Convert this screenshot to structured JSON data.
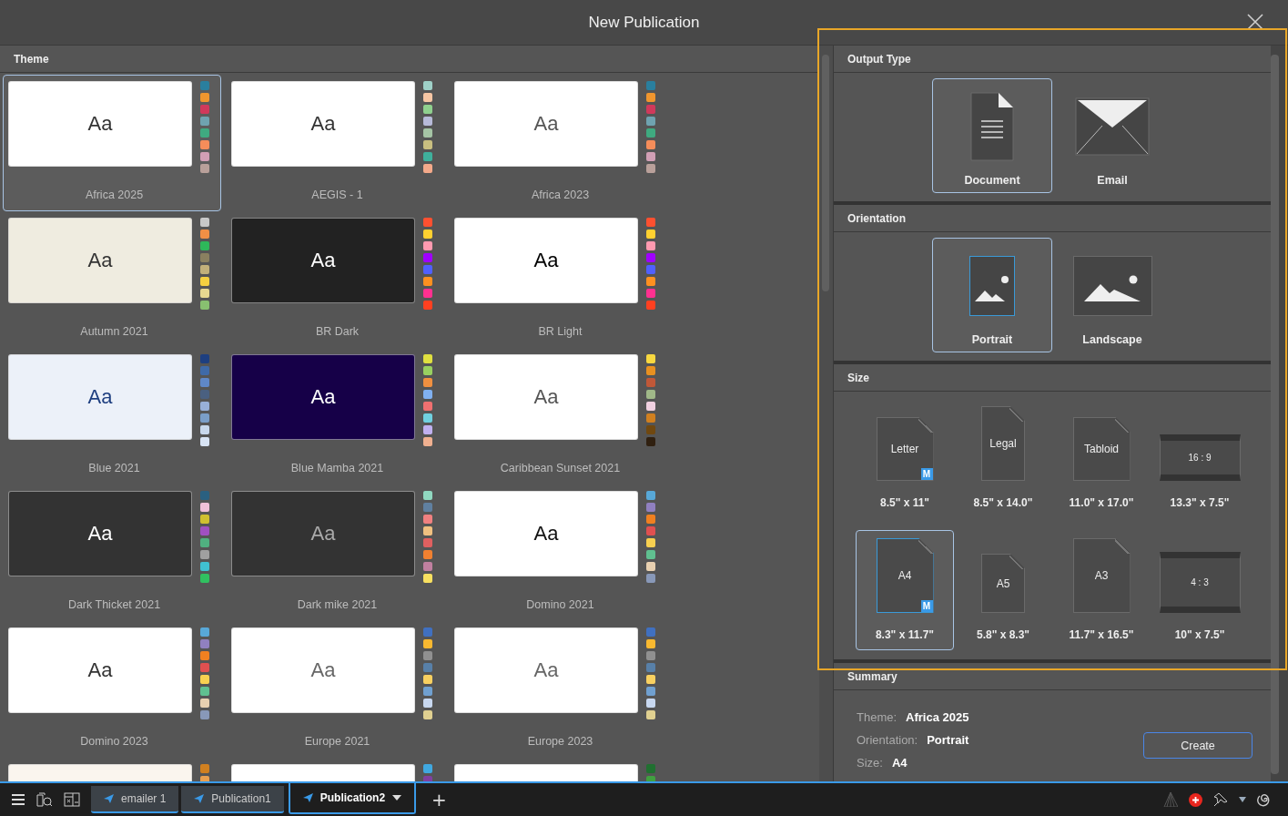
{
  "window": {
    "title": "New Publication"
  },
  "theme_panel": {
    "title": "Theme",
    "themes": [
      {
        "name": "Africa 2025",
        "sample": {
          "text": "Aa",
          "color": "#333333"
        },
        "selected": true,
        "preview": {
          "color": "#ffffff"
        },
        "swatches": [
          {
            "color": "#2a7f9e"
          },
          {
            "color": "#f0962e"
          },
          {
            "color": "#d0395b"
          },
          {
            "color": "#6fa3b0"
          },
          {
            "color": "#3faa80"
          },
          {
            "color": "#f58d5a"
          },
          {
            "color": "#d19fb5"
          },
          {
            "color": "#b9a09a"
          }
        ]
      },
      {
        "name": "AEGIS - 1",
        "sample": {
          "text": "Aa",
          "color": "#333333"
        },
        "selected": false,
        "preview": {
          "color": "#ffffff"
        },
        "swatches": [
          {
            "color": "#9fd1c8"
          },
          {
            "color": "#f6c6a4"
          },
          {
            "color": "#8fd08e"
          },
          {
            "color": "#b7bad8"
          },
          {
            "color": "#a5c4a5"
          },
          {
            "color": "#c9bf80"
          },
          {
            "color": "#3fb09c"
          },
          {
            "color": "#f4a98a"
          }
        ]
      },
      {
        "name": "Africa 2023",
        "sample": {
          "text": "Aa",
          "color": "#555555"
        },
        "selected": false,
        "preview": {
          "color": "#ffffff"
        },
        "swatches": [
          {
            "color": "#2a7f9e"
          },
          {
            "color": "#f0962e"
          },
          {
            "color": "#d0395b"
          },
          {
            "color": "#6fa3b0"
          },
          {
            "color": "#3faa80"
          },
          {
            "color": "#f58d5a"
          },
          {
            "color": "#d19fb5"
          },
          {
            "color": "#b9a09a"
          }
        ]
      },
      {
        "name": "Autumn 2021",
        "sample": {
          "text": "Aa",
          "color": "#333333"
        },
        "selected": false,
        "preview": {
          "color": "#efece0"
        },
        "swatches": [
          {
            "color": "#c8c8c8"
          },
          {
            "color": "#f08f45"
          },
          {
            "color": "#2eb85a"
          },
          {
            "color": "#8a8060"
          },
          {
            "color": "#c2b07a"
          },
          {
            "color": "#f5d040"
          },
          {
            "color": "#e8d890"
          },
          {
            "color": "#88c070"
          }
        ]
      },
      {
        "name": "BR Dark",
        "sample": {
          "text": "Aa",
          "color": "#ffffff"
        },
        "selected": false,
        "preview": {
          "color": "#222222"
        },
        "swatches": [
          {
            "color": "#ff5030"
          },
          {
            "color": "#ffd030"
          },
          {
            "color": "#ff9ab0"
          },
          {
            "color": "#a000ff"
          },
          {
            "color": "#5060ff"
          },
          {
            "color": "#ff9020"
          },
          {
            "color": "#ff3090"
          },
          {
            "color": "#ff4020"
          }
        ]
      },
      {
        "name": "BR Light",
        "sample": {
          "text": "Aa",
          "color": "#000000"
        },
        "selected": false,
        "preview": {
          "color": "#ffffff"
        },
        "swatches": [
          {
            "color": "#ff5030"
          },
          {
            "color": "#ffd030"
          },
          {
            "color": "#ff9ab0"
          },
          {
            "color": "#a000ff"
          },
          {
            "color": "#5060ff"
          },
          {
            "color": "#ff9020"
          },
          {
            "color": "#ff3090"
          },
          {
            "color": "#ff4020"
          }
        ]
      },
      {
        "name": "Blue 2021",
        "sample": {
          "text": "Aa",
          "color": "#1e3f80"
        },
        "selected": false,
        "preview": {
          "color": "#ecf1f9"
        },
        "swatches": [
          {
            "color": "#1e3f80"
          },
          {
            "color": "#3f6aa8"
          },
          {
            "color": "#5f88c8"
          },
          {
            "color": "#4a6080"
          },
          {
            "color": "#98b0d8"
          },
          {
            "color": "#7a9ec8"
          },
          {
            "color": "#c8d8ec"
          },
          {
            "color": "#d8e4f4"
          }
        ]
      },
      {
        "name": "Blue Mamba 2021",
        "sample": {
          "text": "Aa",
          "color": "#ffffff"
        },
        "selected": false,
        "preview": {
          "color": "#160048"
        },
        "swatches": [
          {
            "color": "#e0e040"
          },
          {
            "color": "#98d060"
          },
          {
            "color": "#f09040"
          },
          {
            "color": "#80b0f0"
          },
          {
            "color": "#f07070"
          },
          {
            "color": "#70d0e0"
          },
          {
            "color": "#c0b0f0"
          },
          {
            "color": "#f0b090"
          }
        ]
      },
      {
        "name": "Caribbean Sunset 2021",
        "sample": {
          "text": "Aa",
          "color": "#555555"
        },
        "selected": false,
        "preview": {
          "color": "#ffffff"
        },
        "swatches": [
          {
            "color": "#f8d840"
          },
          {
            "color": "#e89020"
          },
          {
            "color": "#c05838"
          },
          {
            "color": "#a0b888"
          },
          {
            "color": "#f0d0e0"
          },
          {
            "color": "#d08020"
          },
          {
            "color": "#704810"
          },
          {
            "color": "#302010"
          }
        ]
      },
      {
        "name": "Dark Thicket 2021",
        "sample": {
          "text": "Aa",
          "color": "#ffffff"
        },
        "selected": false,
        "preview": {
          "color": "#333333"
        },
        "swatches": [
          {
            "color": "#2a6080"
          },
          {
            "color": "#f0c0d8"
          },
          {
            "color": "#d0c030"
          },
          {
            "color": "#a050c0"
          },
          {
            "color": "#50b080"
          },
          {
            "color": "#a0a0a0"
          },
          {
            "color": "#40c0d0"
          },
          {
            "color": "#30c060"
          }
        ]
      },
      {
        "name": "Dark mike 2021",
        "sample": {
          "text": "Aa",
          "color": "#aaaaaa"
        },
        "selected": false,
        "preview": {
          "color": "#333333"
        },
        "swatches": [
          {
            "color": "#90d8c0"
          },
          {
            "color": "#6080a0"
          },
          {
            "color": "#f08080"
          },
          {
            "color": "#f0c080"
          },
          {
            "color": "#e06060"
          },
          {
            "color": "#f08030"
          },
          {
            "color": "#c080a0"
          },
          {
            "color": "#f8e060"
          }
        ]
      },
      {
        "name": "Domino 2021",
        "sample": {
          "text": "Aa",
          "color": "#111111"
        },
        "selected": false,
        "preview": {
          "color": "#ffffff"
        },
        "swatches": [
          {
            "color": "#58a8d8"
          },
          {
            "color": "#9080c0"
          },
          {
            "color": "#f08020"
          },
          {
            "color": "#e05050"
          },
          {
            "color": "#f8d050"
          },
          {
            "color": "#60c090"
          },
          {
            "color": "#e8d0b0"
          },
          {
            "color": "#8898b8"
          }
        ]
      },
      {
        "name": "Domino 2023",
        "sample": {
          "text": "Aa",
          "color": "#333333"
        },
        "selected": false,
        "preview": {
          "color": "#ffffff"
        },
        "swatches": [
          {
            "color": "#58a8d8"
          },
          {
            "color": "#9080c0"
          },
          {
            "color": "#f08020"
          },
          {
            "color": "#e05050"
          },
          {
            "color": "#f8d050"
          },
          {
            "color": "#60c090"
          },
          {
            "color": "#e8d0b0"
          },
          {
            "color": "#8898b8"
          }
        ]
      },
      {
        "name": "Europe 2021",
        "sample": {
          "text": "Aa",
          "color": "#666666"
        },
        "selected": false,
        "preview": {
          "color": "#ffffff"
        },
        "swatches": [
          {
            "color": "#4070c0"
          },
          {
            "color": "#f8b830"
          },
          {
            "color": "#909090"
          },
          {
            "color": "#5880a8"
          },
          {
            "color": "#f8d060"
          },
          {
            "color": "#70a0d0"
          },
          {
            "color": "#c8d8f0"
          },
          {
            "color": "#e0d090"
          }
        ]
      },
      {
        "name": "Europe 2023",
        "sample": {
          "text": "Aa",
          "color": "#666666"
        },
        "selected": false,
        "preview": {
          "color": "#ffffff"
        },
        "swatches": [
          {
            "color": "#4070c0"
          },
          {
            "color": "#f8b830"
          },
          {
            "color": "#909090"
          },
          {
            "color": "#5880a8"
          },
          {
            "color": "#f8d060"
          },
          {
            "color": "#70a0d0"
          },
          {
            "color": "#c8d8f0"
          },
          {
            "color": "#e0d090"
          }
        ]
      },
      {
        "selected": false,
        "preview": {
          "color": "#faf5ee"
        },
        "swatches": [
          {
            "color": "#d08020"
          },
          {
            "color": "#e8a050"
          }
        ]
      },
      {
        "selected": false,
        "preview": {
          "color": "#ffffff"
        },
        "swatches": [
          {
            "color": "#40a8e0"
          },
          {
            "color": "#8040a0"
          }
        ]
      },
      {
        "selected": false,
        "preview": {
          "color": "#ffffff"
        },
        "swatches": [
          {
            "color": "#207030"
          },
          {
            "color": "#40a040"
          }
        ]
      }
    ]
  },
  "output_type": {
    "title": "Output Type",
    "options": [
      {
        "label": "Document",
        "kind": "document",
        "selected": true
      },
      {
        "label": "Email",
        "kind": "email",
        "selected": false
      }
    ]
  },
  "orientation": {
    "title": "Orientation",
    "options": [
      {
        "label": "Portrait",
        "kind": "portrait",
        "selected": true
      },
      {
        "label": "Landscape",
        "kind": "landscape",
        "selected": false
      }
    ]
  },
  "size": {
    "title": "Size",
    "options": [
      {
        "name": "Letter",
        "dims": "8.5\" x 11\"",
        "kind": "page",
        "badge": "M",
        "selected": false
      },
      {
        "name": "Legal",
        "dims": "8.5\" x 14.0\"",
        "kind": "page",
        "selected": false
      },
      {
        "name": "Tabloid",
        "dims": "11.0\" x 17.0\"",
        "kind": "page",
        "selected": false
      },
      {
        "name": "16 : 9",
        "dims": "13.3\" x 7.5\"",
        "kind": "screen",
        "selected": false
      },
      {
        "name": "A4",
        "dims": "8.3\" x 11.7\"",
        "kind": "page",
        "badge": "M",
        "selected": true
      },
      {
        "name": "A5",
        "dims": "5.8\" x 8.3\"",
        "kind": "page",
        "selected": false
      },
      {
        "name": "A3",
        "dims": "11.7\" x 16.5\"",
        "kind": "page",
        "selected": false
      },
      {
        "name": "4 : 3",
        "dims": "10\" x 7.5\"",
        "kind": "screen",
        "selected": false
      }
    ]
  },
  "summary": {
    "title": "Summary",
    "rows": [
      {
        "label": "Theme:",
        "value": "Africa 2025"
      },
      {
        "label": "Orientation:",
        "value": "Portrait"
      },
      {
        "label": "Size:",
        "value": "A4"
      }
    ],
    "button": "Create"
  },
  "taskbar": {
    "tabs": [
      {
        "label": "emailer 1",
        "selected": false,
        "dropdown": false
      },
      {
        "label": "Publication1",
        "selected": false,
        "dropdown": false
      },
      {
        "label": "Publication2",
        "selected": true,
        "dropdown": true
      }
    ],
    "add": "+"
  }
}
